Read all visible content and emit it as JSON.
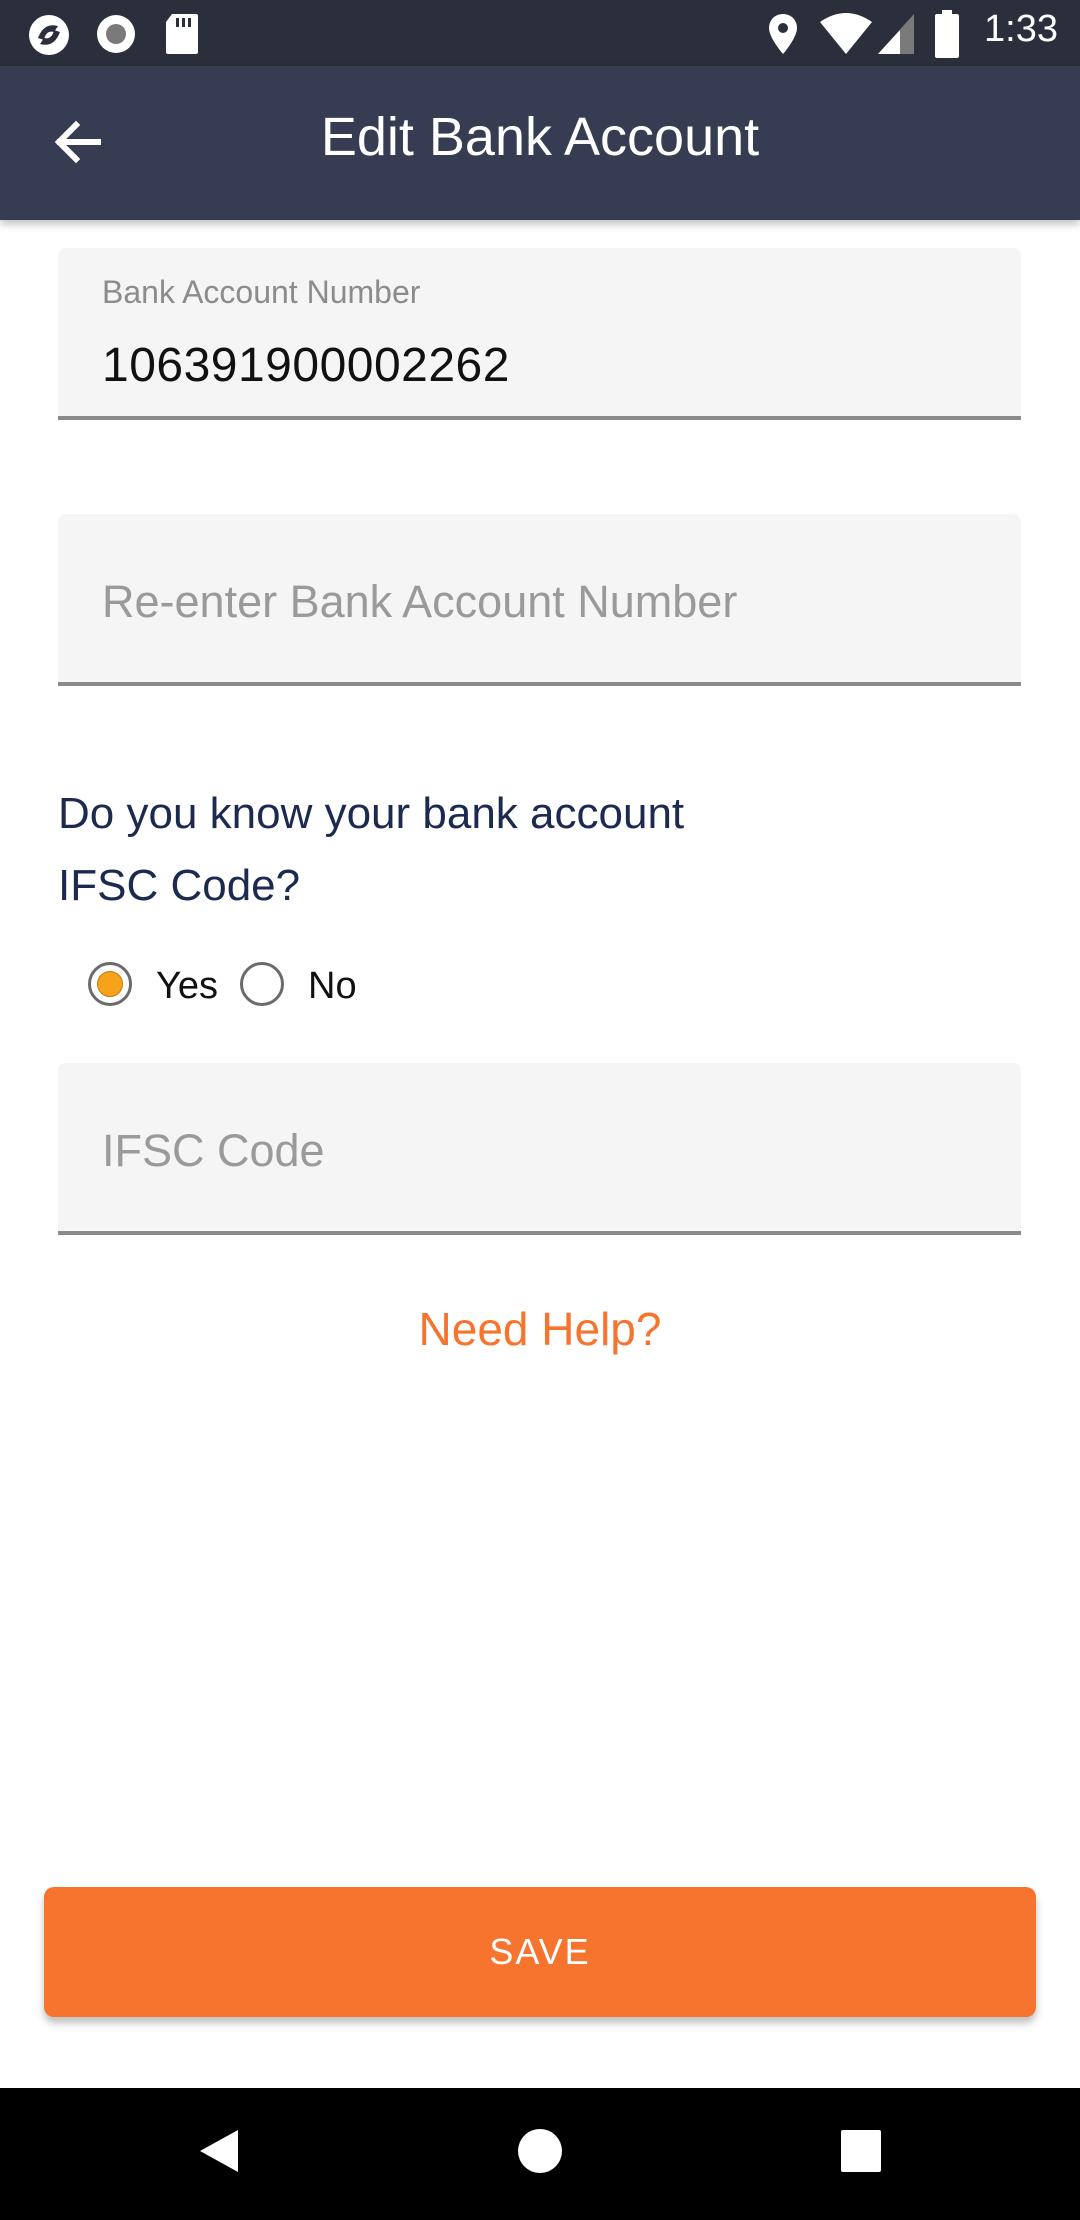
{
  "status_bar": {
    "time": "1:33",
    "icons": [
      "app-icon",
      "record-icon",
      "sd-card-icon",
      "location-icon",
      "wifi-icon",
      "signal-icon",
      "battery-icon"
    ]
  },
  "app_bar": {
    "title": "Edit Bank Account",
    "back_icon": "arrow-left-icon"
  },
  "form": {
    "account_number": {
      "label": "Bank Account Number",
      "value": "106391900002262"
    },
    "reenter_account_number": {
      "placeholder": "Re-enter Bank Account Number",
      "value": ""
    },
    "ifsc_question": {
      "line1": "Do you know your bank account",
      "line2": "IFSC Code?"
    },
    "ifsc_options": {
      "yes_label": "Yes",
      "no_label": "No",
      "selected": "Yes"
    },
    "ifsc_code": {
      "placeholder": "IFSC Code",
      "value": ""
    },
    "help_link": "Need Help?"
  },
  "save_button": {
    "label": "SAVE"
  },
  "colors": {
    "app_bar": "#363d52",
    "accent": "#f7742f",
    "radio_selected": "#f7a21b",
    "question_text": "#1b2a4e"
  },
  "nav_bar": {
    "icons": [
      "back-triangle-icon",
      "home-circle-icon",
      "recents-square-icon"
    ]
  }
}
